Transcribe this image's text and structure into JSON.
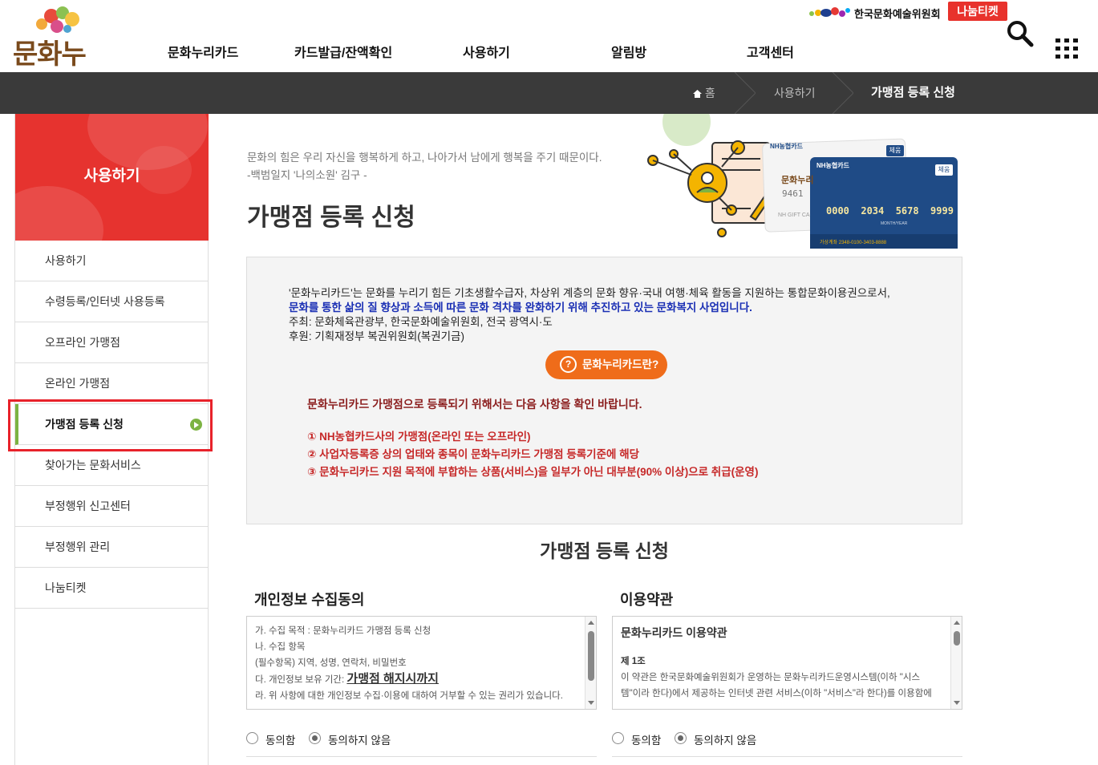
{
  "header": {
    "logo_text": "문화누리",
    "nav": [
      "문화누리카드",
      "카드발급/잔액확인",
      "사용하기",
      "알림방",
      "고객센터"
    ],
    "arts_council": "한국문화예술위원회",
    "nanum_ticket": "나눔티켓"
  },
  "breadcrumb": {
    "home": "홈",
    "level1": "사용하기",
    "current": "가맹점 등록 신청"
  },
  "sidebar": {
    "title": "사용하기",
    "items": [
      {
        "label": "사용하기"
      },
      {
        "label": "수령등록/인터넷 사용등록"
      },
      {
        "label": "오프라인 가맹점"
      },
      {
        "label": "온라인 가맹점"
      },
      {
        "label": "가맹점 등록 신청",
        "active": true
      },
      {
        "label": "찾아가는 문화서비스"
      },
      {
        "label": "부정행위 신고센터"
      },
      {
        "label": "부정행위 관리"
      },
      {
        "label": "나눔티켓"
      }
    ]
  },
  "main": {
    "quote_line1": "문화의 힘은 우리 자신을 행복하게 하고, 나아가서 남에게 행복을 주기 때문이다.",
    "quote_line2": "-백범일지 '나의소원' 김구 -",
    "page_title": "가맹점 등록 신청",
    "hero_card": {
      "brand": "NH농협카드",
      "badge": "체움",
      "number": "0000  2034  5678  9999",
      "account": "가상계좌  2348-0100-3403-8888",
      "valid_label": "MONTH/YEAR",
      "back_number": "9461",
      "back_label": "NH GIFT CA",
      "back_logo": "문화누리"
    },
    "info": {
      "line1": "'문화누리카드'는 문화를 누리기 힘든 기초생활수급자, 차상위 계층의 문화 향유·국내 여행·체육 활동을 지원하는 통합문화이용권으로서,",
      "line2": "문화를 통한 삶의 질 향상과 소득에 따른 문화 격차를 완화하기 위해 추진하고 있는 문화복지 사업입니다.",
      "line3": "주최: 문화체육관광부, 한국문화예술위원회, 전국 광역시·도",
      "line4": "후원: 기획재정부 복권위원회(복권기금)",
      "button_icon": "?",
      "button": "문화누리카드란?",
      "cond_title": "문화누리카드 가맹점으로 등록되기 위해서는 다음 사항을 확인 바랍니다.",
      "conditions": [
        "① NH농협카드사의 가맹점(온라인 또는 오프라인)",
        "② 사업자등록증 상의 업태와 종목이 문화누리카드 가맹점 등록기준에 해당",
        "③ 문화누리카드 지원 목적에 부합하는 상품(서비스)을 일부가 아닌 대부분(90% 이상)으로 취급(운영)"
      ]
    },
    "section_title": "가맹점 등록 신청",
    "privacy": {
      "title": "개인정보 수집동의",
      "lines": [
        "가. 수집 목적 : 문화누리카드 가맹점 등록 신청",
        "나. 수집 항목",
        "(필수항목) 지역, 성명, 연락처, 비밀번호",
        "라. 위 사항에 대한 개인정보 수집·이용에 대하여 거부할 수 있는 권리가 있습니다."
      ],
      "retention_prefix": "다. 개인정보 보유 기간: ",
      "retention_value": "가맹점 해지시까지",
      "agree": "동의함",
      "disagree": "동의하지 않음"
    },
    "terms": {
      "title": "이용약관",
      "heading": "문화누리카드 이용약관",
      "article": "제 1조",
      "text1": "이 약관은 한국문화예술위원회가 운영하는 문화누리카드운영시스템(이하 \"시스",
      "text2": "템\"이라 한다)에서 제공하는 인터넷 관련 서비스(이하 \"서비스\"라 한다)를 이용함에",
      "agree": "동의함",
      "disagree": "동의하지 않음"
    }
  },
  "colors": {
    "accent_red": "#e6332f",
    "active_green": "#7cb342",
    "button_orange": "#ef6c1a",
    "breadcrumb_bg": "#3a3a3a"
  }
}
